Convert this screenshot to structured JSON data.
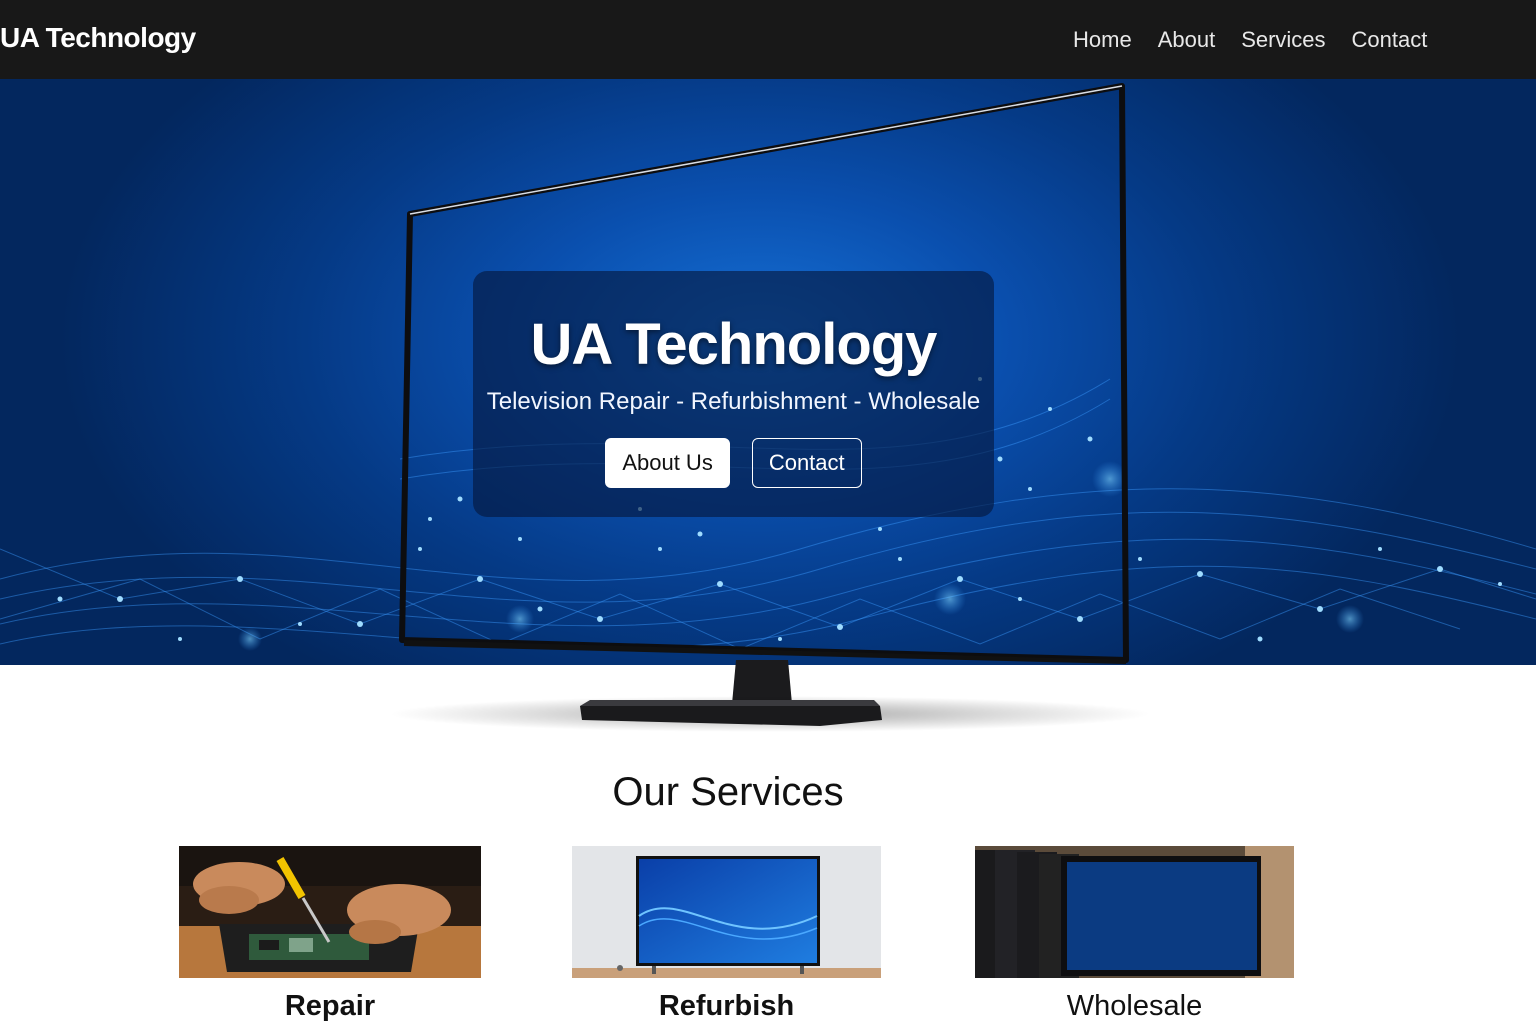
{
  "navbar": {
    "brand": "UA Technology",
    "links": [
      "Home",
      "About",
      "Services",
      "Contact"
    ]
  },
  "hero": {
    "title": "UA Technology",
    "subtitle": "Television Repair - Refurbishment - Wholesale",
    "buttons": {
      "primary": "About Us",
      "secondary": "Contact"
    }
  },
  "services": {
    "heading": "Our Services",
    "items": [
      {
        "label": "Repair",
        "image": "hands-repairing-circuit-board-photo"
      },
      {
        "label": "Refurbish",
        "image": "refurbished-tv-on-stand-photo"
      },
      {
        "label": "Wholesale",
        "image": "stacked-tv-monitors-photo"
      }
    ]
  },
  "colors": {
    "navbar_bg": "#181818",
    "hero_blue": "#0a4fae",
    "card_overlay": "#05163c"
  }
}
